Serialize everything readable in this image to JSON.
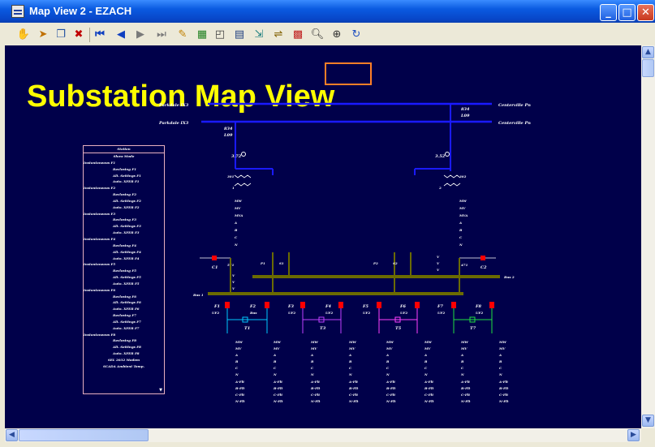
{
  "window": {
    "title": "Map View  2  - EZACH",
    "buttons": {
      "minimize": "_",
      "maximize": "□",
      "close": "✕"
    }
  },
  "toolbar": {
    "tools": [
      "hand-icon",
      "select-icon",
      "copy-icon",
      "delete-icon",
      "first-icon",
      "prev-icon",
      "next-icon",
      "last-icon",
      "edit-icon",
      "chart-icon",
      "window-icon",
      "form-icon",
      "export-icon",
      "link-icon",
      "grid-icon",
      "zoom-icon",
      "globe-icon",
      "refresh-icon"
    ]
  },
  "map": {
    "title": "Substation  Map View",
    "orange_box_label": " ",
    "feeder_left_top": "Parkdale IX3",
    "feeder_left_bot": "Parkdale IX3",
    "feeder_right_top": "Centerville Pn",
    "feeder_right_bot": "Centerville Pn",
    "line_label_1": "834",
    "line_label_2": "L09",
    "line_label_3": "834",
    "line_label_4": "L09",
    "left_tx_label": "3.72",
    "right_tx_label": "3.52",
    "left_breaker": "301",
    "right_breaker": "302",
    "left_tx_num": "1",
    "right_tx_num": "2",
    "meter_labels": [
      "MW",
      "MV",
      "MVA",
      "A",
      "B",
      "C",
      "N"
    ],
    "cap_left": "C1",
    "cap_right": "C2",
    "cap_left_num": "571",
    "cap_right_num": "471",
    "bus_left": "Bus 1",
    "bus_right": "Bus 2",
    "vvv": [
      "V",
      "V",
      "V"
    ],
    "vvv2": [
      "V",
      "V",
      "V"
    ],
    "p1": "P1",
    "s1": "S1",
    "p2": "P2",
    "s2": "S2",
    "feeders": [
      {
        "f": "F1",
        "u": "UF2",
        "t": "T1"
      },
      {
        "f": "F2",
        "u": "Bus",
        "t": ""
      },
      {
        "f": "F3",
        "u": "UF2",
        "t": "T3"
      },
      {
        "f": "F4",
        "u": "UF2",
        "t": ""
      },
      {
        "f": "F5",
        "u": "UF2",
        "t": "T5"
      },
      {
        "f": "F6",
        "u": "UF2",
        "t": ""
      },
      {
        "f": "F7",
        "u": "UF2",
        "t": "T7"
      },
      {
        "f": "F8",
        "u": "UF2",
        "t": ""
      }
    ],
    "feeder_meters": [
      "MW",
      "MV",
      "A",
      "B",
      "C",
      "N"
    ],
    "feeder_flt": [
      "A-Flt",
      "B-Flt",
      "C-Flt",
      "N-Flt"
    ]
  },
  "panel": {
    "header": "Station",
    "rows": [
      {
        "text": "Show Mode",
        "style": "center"
      },
      {
        "text": "Instantaneous F1",
        "style": "left"
      },
      {
        "text": "Reclosing F1",
        "style": "indent"
      },
      {
        "text": "Alt. Settings F1",
        "style": "indent"
      },
      {
        "text": "Auto. XFER F1",
        "style": "indent"
      },
      {
        "text": "Instantaneous F2",
        "style": "left"
      },
      {
        "text": "Reclosing F2",
        "style": "indent"
      },
      {
        "text": "Alt. Settings F2",
        "style": "indent"
      },
      {
        "text": "Auto. XFER F2",
        "style": "indent"
      },
      {
        "text": "Instantaneous F3",
        "style": "left"
      },
      {
        "text": "Reclosing F3",
        "style": "indent"
      },
      {
        "text": "Alt. Settings F3",
        "style": "indent"
      },
      {
        "text": "Auto. XFER F3",
        "style": "indent"
      },
      {
        "text": "Instantaneous F4",
        "style": "left"
      },
      {
        "text": "Reclosing F4",
        "style": "indent"
      },
      {
        "text": "Alt. Settings F4",
        "style": "indent"
      },
      {
        "text": "Auto. XFER F4",
        "style": "indent"
      },
      {
        "text": "Instantaneous F5",
        "style": "left"
      },
      {
        "text": "Reclosing F5",
        "style": "indent"
      },
      {
        "text": "Alt. Settings F5",
        "style": "indent"
      },
      {
        "text": "Auto. XFER F5",
        "style": "indent"
      },
      {
        "text": "Instantaneous F6",
        "style": "left"
      },
      {
        "text": "Reclosing F6",
        "style": "indent"
      },
      {
        "text": "Alt. Settings F6",
        "style": "indent"
      },
      {
        "text": "Auto. XFER F6",
        "style": "indent"
      },
      {
        "text": "Reclosing F7",
        "style": "indent"
      },
      {
        "text": "Alt. Settings F7",
        "style": "indent"
      },
      {
        "text": "Auto. XFER F7",
        "style": "indent"
      },
      {
        "text": "Instantaneous F8",
        "style": "left"
      },
      {
        "text": "Reclosing F8",
        "style": "indent"
      },
      {
        "text": "Alt. Settings F8",
        "style": "indent"
      },
      {
        "text": "Auto. XFER F8",
        "style": "indent"
      },
      {
        "text": "SEL 2032 Modem",
        "style": "center"
      },
      {
        "text": "SCADA Ambient Temp.",
        "style": "center"
      }
    ],
    "scroll_arrow": "▼"
  },
  "colors": {
    "canvas_bg": "#00004a",
    "title_yellow": "#ffff00",
    "busbar_olive": "#6b6b00",
    "line_blue": "#1a1aff",
    "breaker_red": "#ff0000",
    "panel_border": "#e8b0c0"
  }
}
